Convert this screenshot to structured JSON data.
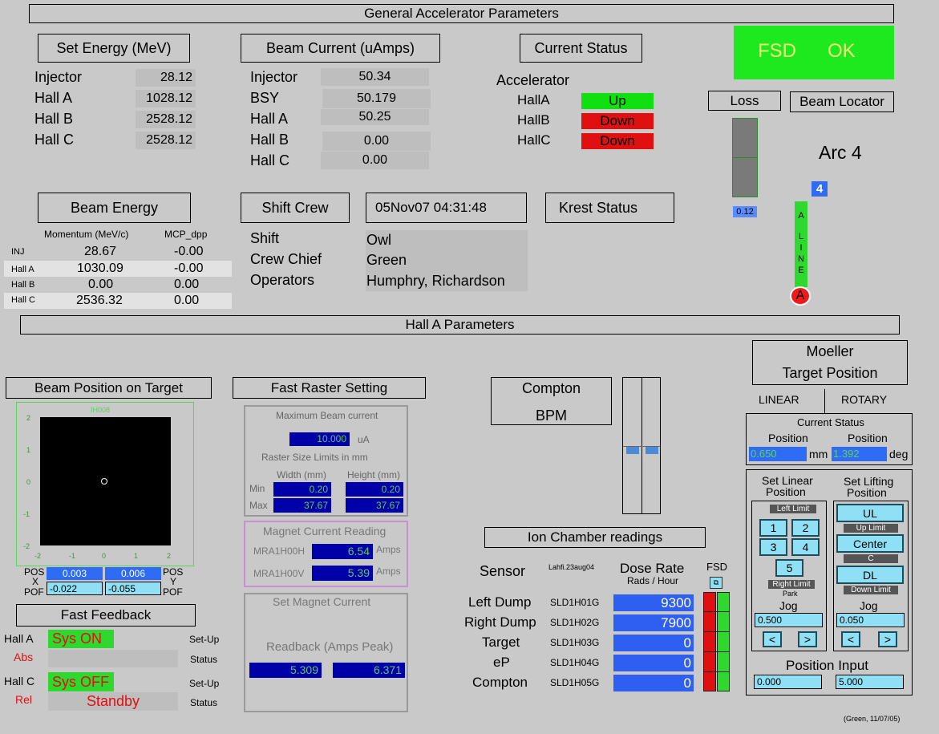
{
  "general": {
    "title": "General Accelerator Parameters",
    "set_energy": {
      "title": "Set Energy (MeV)",
      "rows": [
        {
          "label": "Injector",
          "value": "28.12"
        },
        {
          "label": "Hall A",
          "value": "1028.12"
        },
        {
          "label": "Hall B",
          "value": "2528.12"
        },
        {
          "label": "Hall C",
          "value": "2528.12"
        }
      ]
    },
    "beam_current": {
      "title": "Beam Current (uAmps)",
      "rows": [
        {
          "label": "Injector",
          "value": "50.34"
        },
        {
          "label": "BSY",
          "value": "50.179"
        },
        {
          "label": "Hall A",
          "value": "50.25"
        },
        {
          "label": "Hall B",
          "value": "0.00"
        },
        {
          "label": "Hall C",
          "value": "0.00"
        }
      ]
    },
    "current_status": {
      "title": "Current Status",
      "accelerator_label": "Accelerator",
      "rows": [
        {
          "label": "HallA",
          "value": "Up",
          "color": "#10e010"
        },
        {
          "label": "HallB",
          "value": "Down",
          "color": "#e01010"
        },
        {
          "label": "HallC",
          "value": "Down",
          "color": "#e01010"
        }
      ]
    },
    "fsd": {
      "label": "FSD",
      "value": "OK",
      "color": "#1ee81e"
    },
    "loss": {
      "title": "Loss",
      "value": "0.12"
    },
    "beam_locator": {
      "title": "Beam Locator",
      "arc": "Arc 4",
      "arc_number": "4",
      "line_letters": [
        "A",
        "L",
        "I",
        "N",
        "E"
      ],
      "line_marker": "A"
    },
    "beam_energy": {
      "title": "Beam Energy",
      "col1": "Momentum (MeV/c)",
      "col2": "MCP_dpp",
      "rows": [
        {
          "label": "INJ",
          "momentum": "28.67",
          "dpp": "-0.00"
        },
        {
          "label": "Hall A",
          "momentum": "1030.09",
          "dpp": "-0.00"
        },
        {
          "label": "Hall B",
          "momentum": "0.00",
          "dpp": "0.00"
        },
        {
          "label": "Hall C",
          "momentum": "2536.32",
          "dpp": "0.00"
        }
      ]
    },
    "shift_crew": {
      "title": "Shift Crew",
      "timestamp": "05Nov07 04:31:48",
      "rows": [
        {
          "label": "Shift",
          "value": "Owl"
        },
        {
          "label": "Crew Chief",
          "value": "Green"
        },
        {
          "label": "Operators",
          "value": "Humphry, Richardson"
        }
      ]
    },
    "krest": {
      "title": "Krest Status"
    }
  },
  "halla": {
    "title": "Hall A Parameters",
    "beam_position": {
      "title": "Beam Position on Target",
      "plot_label": "IH008",
      "y_ticks": [
        "2",
        "1",
        "0",
        "-1",
        "-2"
      ],
      "x_ticks": [
        "-2",
        "-1",
        "0",
        "1",
        "2"
      ],
      "pos_label": "POS",
      "pof_label": "POF",
      "x_label": "X",
      "y_label": "Y",
      "pos_x": "0.003",
      "pos_y": "0.006",
      "pof_x": "-0.022",
      "pof_y": "-0.055"
    },
    "fast_feedback": {
      "title": "Fast Feedback",
      "rows": [
        {
          "hall": "Hall A",
          "mode": "Abs",
          "sys": "Sys  ON",
          "sys_color": "#e01010",
          "status": "",
          "setup": "Set-Up",
          "status_label": "Status"
        },
        {
          "hall": "Hall C",
          "mode": "Rel",
          "sys": "Sys OFF",
          "sys_color": "#e01010",
          "status": "Standby",
          "setup": "Set-Up",
          "status_label": "Status"
        }
      ]
    },
    "fast_raster": {
      "title": "Fast Raster Setting",
      "max_beam_label": "Maximum Beam current",
      "max_beam_value": "10.000",
      "max_beam_unit": "uA",
      "size_limits_label": "Raster Size Limits in mm",
      "width_label": "Width (mm)",
      "height_label": "Height (mm)",
      "min_label": "Min",
      "max_label": "Max",
      "min_width": "0.20",
      "min_height": "0.20",
      "max_width": "37.67",
      "max_height": "37.67",
      "magnet_reading_label": "Magnet Current Reading",
      "mra_h_label": "MRA1H00H",
      "mra_h_value": "6.54",
      "mra_v_label": "MRA1H00V",
      "mra_v_value": "5.39",
      "amps": "Amps",
      "set_magnet_label": "Set Magnet Current",
      "readback_label": "Readback (Amps Peak)",
      "readback_1": "5.309",
      "readback_2": "6.371"
    },
    "compton": {
      "title_1": "Compton",
      "title_2": "BPM"
    },
    "ion_chamber": {
      "title": "Ion Chamber readings",
      "sensor_label": "Sensor",
      "sensor_small": "Lahfi.23aug04",
      "dose_label": "Dose Rate",
      "dose_unit": "Rads / Hour",
      "fsd_label": "FSD",
      "rows": [
        {
          "name": "Left Dump",
          "id": "SLD1H01G",
          "value": "9300"
        },
        {
          "name": "Right Dump",
          "id": "SLD1H02G",
          "value": "7900"
        },
        {
          "name": "Target",
          "id": "SLD1H03G",
          "value": "0"
        },
        {
          "name": "eP",
          "id": "SLD1H04G",
          "value": "0"
        },
        {
          "name": "Compton",
          "id": "SLD1H05G",
          "value": "0"
        }
      ]
    },
    "moeller": {
      "title_1": "Moeller",
      "title_2": "Target Position",
      "linear_label": "LINEAR",
      "rotary_label": "ROTARY",
      "current_status_label": "Current Status",
      "position_label": "Position",
      "linear_position": "0.650",
      "linear_unit": "mm",
      "rotary_position": "1.392",
      "rotary_unit": "deg",
      "set_linear_label_1": "Set Linear",
      "set_linear_label_2": "Position",
      "set_lifting_label_1": "Set Lifting",
      "set_lifting_label_2": "Position",
      "left_limit": "Left Limit",
      "right_limit": "Right Limit",
      "park": "Park",
      "up_limit": "Up Limit",
      "c_label": "C",
      "down_limit": "Down Limit",
      "btn_1": "1",
      "btn_2": "2",
      "btn_3": "3",
      "btn_4": "4",
      "btn_5": "5",
      "btn_ul": "UL",
      "btn_center": "Center",
      "btn_dl": "DL",
      "jog_label": "Jog",
      "linear_jog": "0.500",
      "lifting_jog": "0.050",
      "jog_left": "<",
      "jog_right": ">",
      "position_input_label": "Position Input",
      "linear_input": "0.000",
      "lifting_input": "5.000"
    },
    "footer_note": "(Green, 11/07/05)"
  }
}
